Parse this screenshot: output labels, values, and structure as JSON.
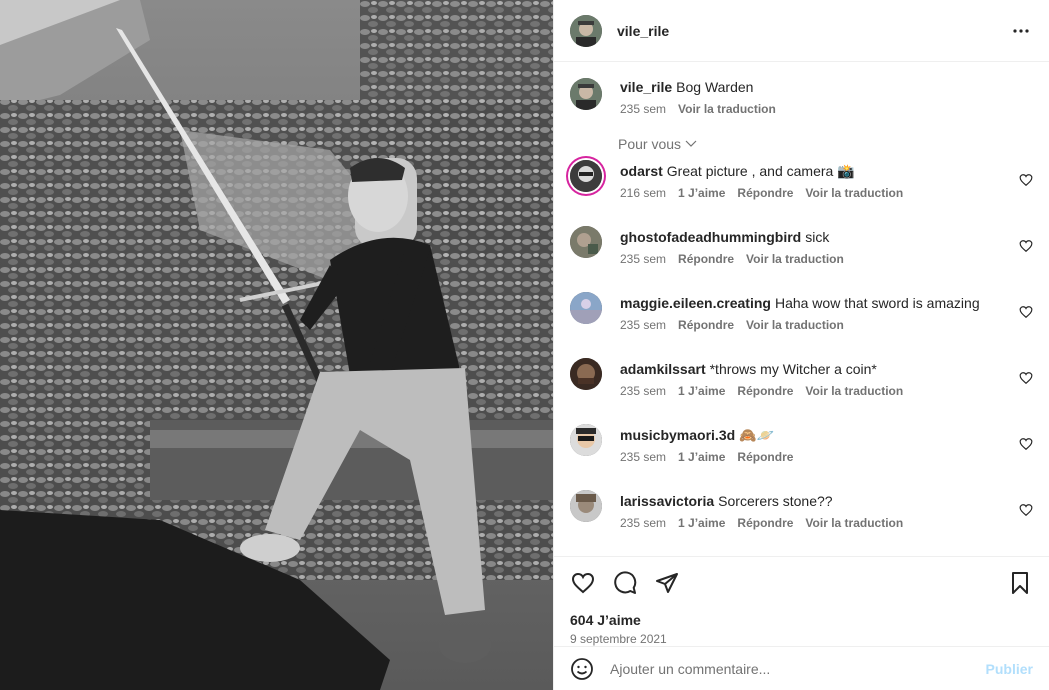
{
  "post": {
    "username": "vile_rile",
    "caption_text": "Bog Warden",
    "caption_age": "235 sem",
    "translate_label": "Voir la traduction",
    "for_you_label": "Pour vous"
  },
  "comments": [
    {
      "username": "odarst",
      "text": "Great picture , and camera 📸",
      "age": "216 sem",
      "likes": "1 J’aime",
      "reply": "Répondre",
      "translate": "Voir la traduction"
    },
    {
      "username": "ghostofadeadhummingbird",
      "text": "sick",
      "age": "235 sem",
      "likes": "",
      "reply": "Répondre",
      "translate": "Voir la traduction"
    },
    {
      "username": "maggie.eileen.creating",
      "text": "Haha wow that sword is amazing",
      "age": "235 sem",
      "likes": "",
      "reply": "Répondre",
      "translate": "Voir la traduction"
    },
    {
      "username": "adamkilssart",
      "text": "*throws my Witcher a coin*",
      "age": "235 sem",
      "likes": "1 J’aime",
      "reply": "Répondre",
      "translate": "Voir la traduction"
    },
    {
      "username": "musicbymaori.3d",
      "text": "🙈🪐",
      "age": "235 sem",
      "likes": "1 J’aime",
      "reply": "Répondre",
      "translate": ""
    },
    {
      "username": "larissavictoria",
      "text": "Sorcerers stone??",
      "age": "235 sem",
      "likes": "1 J’aime",
      "reply": "Répondre",
      "translate": "Voir la traduction"
    }
  ],
  "footer": {
    "likes_count": "604 J’aime",
    "date": "9 septembre 2021",
    "comment_placeholder": "Ajouter un commentaire...",
    "publish_label": "Publier"
  },
  "icons": {
    "more": "more-horizontal-icon",
    "like": "heart-icon",
    "comment": "comment-icon",
    "share": "share-icon",
    "save": "bookmark-icon",
    "emoji": "emoji-icon"
  },
  "colors": {
    "text": "#262626",
    "muted": "#737373",
    "border": "#efefef",
    "publish_disabled": "#b2dffc"
  }
}
